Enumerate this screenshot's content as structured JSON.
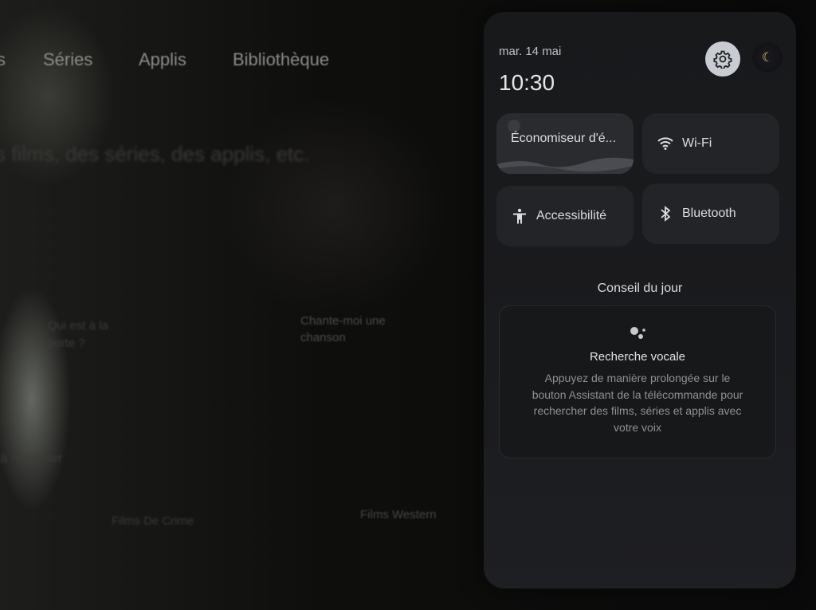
{
  "background": {
    "nav": [
      "s",
      "Séries",
      "Applis",
      "Bibliothèque"
    ],
    "search_hint": "s films, des séries, des applis, etc.",
    "cards": [
      "Qui est à la porte ?",
      "Chante-moi une chanson"
    ],
    "row_label": "à regarder",
    "genres": [
      "Films De Crime",
      "Films Western"
    ]
  },
  "panel": {
    "date": "mar. 14 mai",
    "time": "10:30",
    "settings_icon": "gear-icon",
    "profile_icon": "night-sky-avatar",
    "tiles": [
      {
        "label": "Économiseur d'é...",
        "icon": "screensaver-landscape"
      },
      {
        "label": "Wi-Fi",
        "icon": "wifi-icon"
      },
      {
        "label": "Accessibilité",
        "icon": "accessibility-icon"
      },
      {
        "label": "Bluetooth",
        "icon": "bluetooth-icon"
      }
    ],
    "tip_heading": "Conseil du jour",
    "tip": {
      "icon": "assistant-icon",
      "title": "Recherche vocale",
      "body": "Appuyez de manière prolongée sur le bouton Assistant de la télécommande pour rechercher des films, séries et applis avec votre voix"
    }
  }
}
